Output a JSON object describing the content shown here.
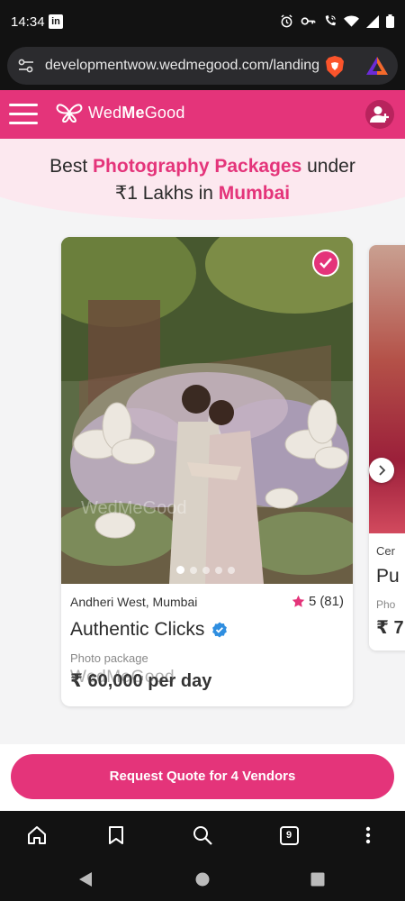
{
  "status_bar": {
    "time": "14:34",
    "app_icon": "linkedin-icon",
    "icons": [
      "alarm-icon",
      "key-icon",
      "wifi-call-icon",
      "wifi-icon",
      "signal-icon",
      "battery-icon"
    ]
  },
  "browser": {
    "url": "developmentwow.wedmegood.com/landing,",
    "tabs_count": "9",
    "toolbar_icons": [
      "home-icon",
      "bookmark-icon",
      "search-icon",
      "tabs-icon",
      "more-icon"
    ]
  },
  "header": {
    "brand_prefix": "Wed",
    "brand_bold": "Me",
    "brand_suffix": "Good",
    "accent_color": "#e4347a"
  },
  "title": {
    "part1": "Best ",
    "highlight1": "Photography Packages",
    "part2": " under",
    "part3": "₹1 Lakhs in ",
    "highlight2": "Mumbai"
  },
  "vendor_card": {
    "location": "Andheri West, Mumbai",
    "rating": "5",
    "reviews": "(81)",
    "name": "Authentic Clicks",
    "package_type": "Photo package",
    "price": "₹ 60,000 per day",
    "watermark": "WedMeGood",
    "photo_watermark": "WedMeGood",
    "carousel_total": 5,
    "carousel_active": 1
  },
  "peek_card": {
    "line1": "Cer",
    "line2": "Pu",
    "line3": "Pho",
    "line4": "₹ 7"
  },
  "cta": {
    "label": "Request Quote for 4 Vendors"
  }
}
